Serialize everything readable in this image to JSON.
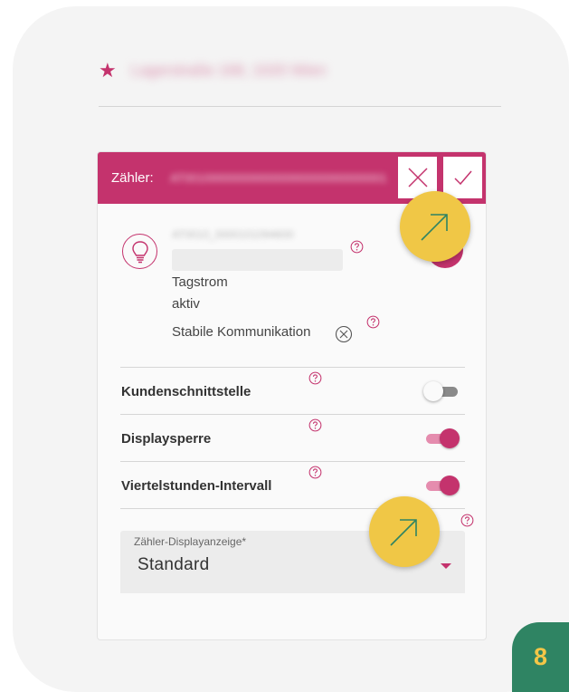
{
  "header": {
    "address_blurred": "Lagerstraße 168, 1020 Wien"
  },
  "card": {
    "title_label": "Zähler:",
    "meter_id_blurred": "AT0010000000000000000000000000001",
    "meter_name_blurred": "AT0010_0000101094600",
    "tariff": "Tagstrom",
    "status": "aktiv",
    "communication": "Stabile Kommunikation"
  },
  "settings": [
    {
      "label": "Kundenschnittstelle",
      "on": false
    },
    {
      "label": "Displaysperre",
      "on": true
    },
    {
      "label": "Viertelstunden-Intervall",
      "on": true
    }
  ],
  "display_select": {
    "label": "Zähler-Displayanzeige*",
    "value": "Standard"
  },
  "step_badge": "8",
  "colors": {
    "accent": "#c4336d",
    "highlight": "#f0c746",
    "badge": "#2f8463"
  },
  "icons": [
    "star-icon",
    "close-icon",
    "check-icon",
    "lightbulb-icon",
    "help-icon",
    "x-circle-icon",
    "caret-down-icon",
    "arrow-up-right-icon"
  ]
}
